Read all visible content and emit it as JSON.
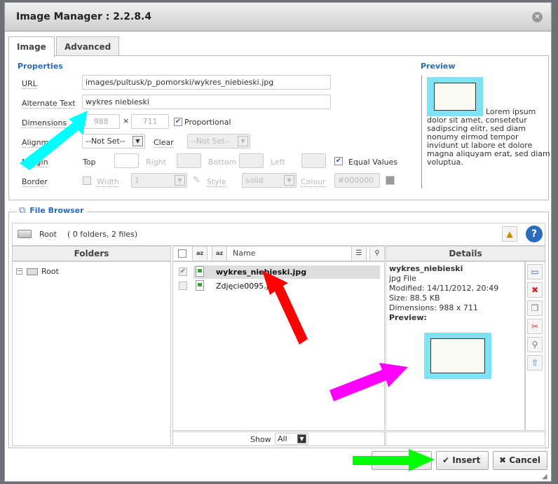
{
  "dialog": {
    "title": "Image Manager : 2.2.8.4"
  },
  "tabs": [
    {
      "label": "Image",
      "active": true
    },
    {
      "label": "Advanced",
      "active": false
    }
  ],
  "properties": {
    "heading": "Properties",
    "url_label": "URL",
    "url_value": "images/pultusk/p_pomorski/wykres_niebieski.jpg",
    "alt_label": "Alternate Text",
    "alt_value": "wykres niebieski",
    "dim_label": "Dimensions",
    "width": "988",
    "height": "711",
    "times": "×",
    "proportional_label": "Proportional",
    "proportional": true,
    "align_label": "Alignment",
    "align_value": "--Not Set--",
    "clear_label": "Clear",
    "clear_value": "--Not Set--",
    "margin_label": "Margin",
    "top_label": "Top",
    "right_label": "Right",
    "bottom_label": "Bottom",
    "left_label": "Left",
    "equal_label": "Equal Values",
    "equal": true,
    "border_label": "Border",
    "width_label": "Width",
    "border_width": "1",
    "style_label": "Style",
    "style_value": "solid",
    "colour_label": "Colour",
    "colour_value": "#000000"
  },
  "preview": {
    "heading": "Preview",
    "text": "Lorem ipsum dolor sit amet, consetetur sadipscing elitr, sed diam nonumy eirmod tempor invidunt ut labore et dolore magna aliquyam erat, sed diam voluptua."
  },
  "file_browser": {
    "heading": "File Browser",
    "path": "Root",
    "summary": "( 0 folders, 2 files)",
    "folders_header": "Folders",
    "name_header": "Name",
    "details_header": "Details",
    "tree": [
      {
        "label": "Root"
      }
    ],
    "files": [
      {
        "name": "wykres_niebieski.jpg",
        "selected": true
      },
      {
        "name": "Zdjęcie0095.jpg",
        "selected": false
      }
    ],
    "show_label": "Show",
    "show_value": "All",
    "details": {
      "name": "wykres_niebieski",
      "type": "jpg File",
      "modified": "Modified: 14/11/2012, 20:49",
      "size": "Size: 88.5 KB",
      "dimensions": "Dimensions: 988 x 711",
      "preview_label": "Preview:"
    }
  },
  "buttons": {
    "insert": "Insert",
    "cancel": "Cancel"
  },
  "annotation_colors": {
    "cyan": "#00ffff",
    "red": "#ff0000",
    "magenta": "#ff00ff",
    "green": "#00ff00"
  }
}
